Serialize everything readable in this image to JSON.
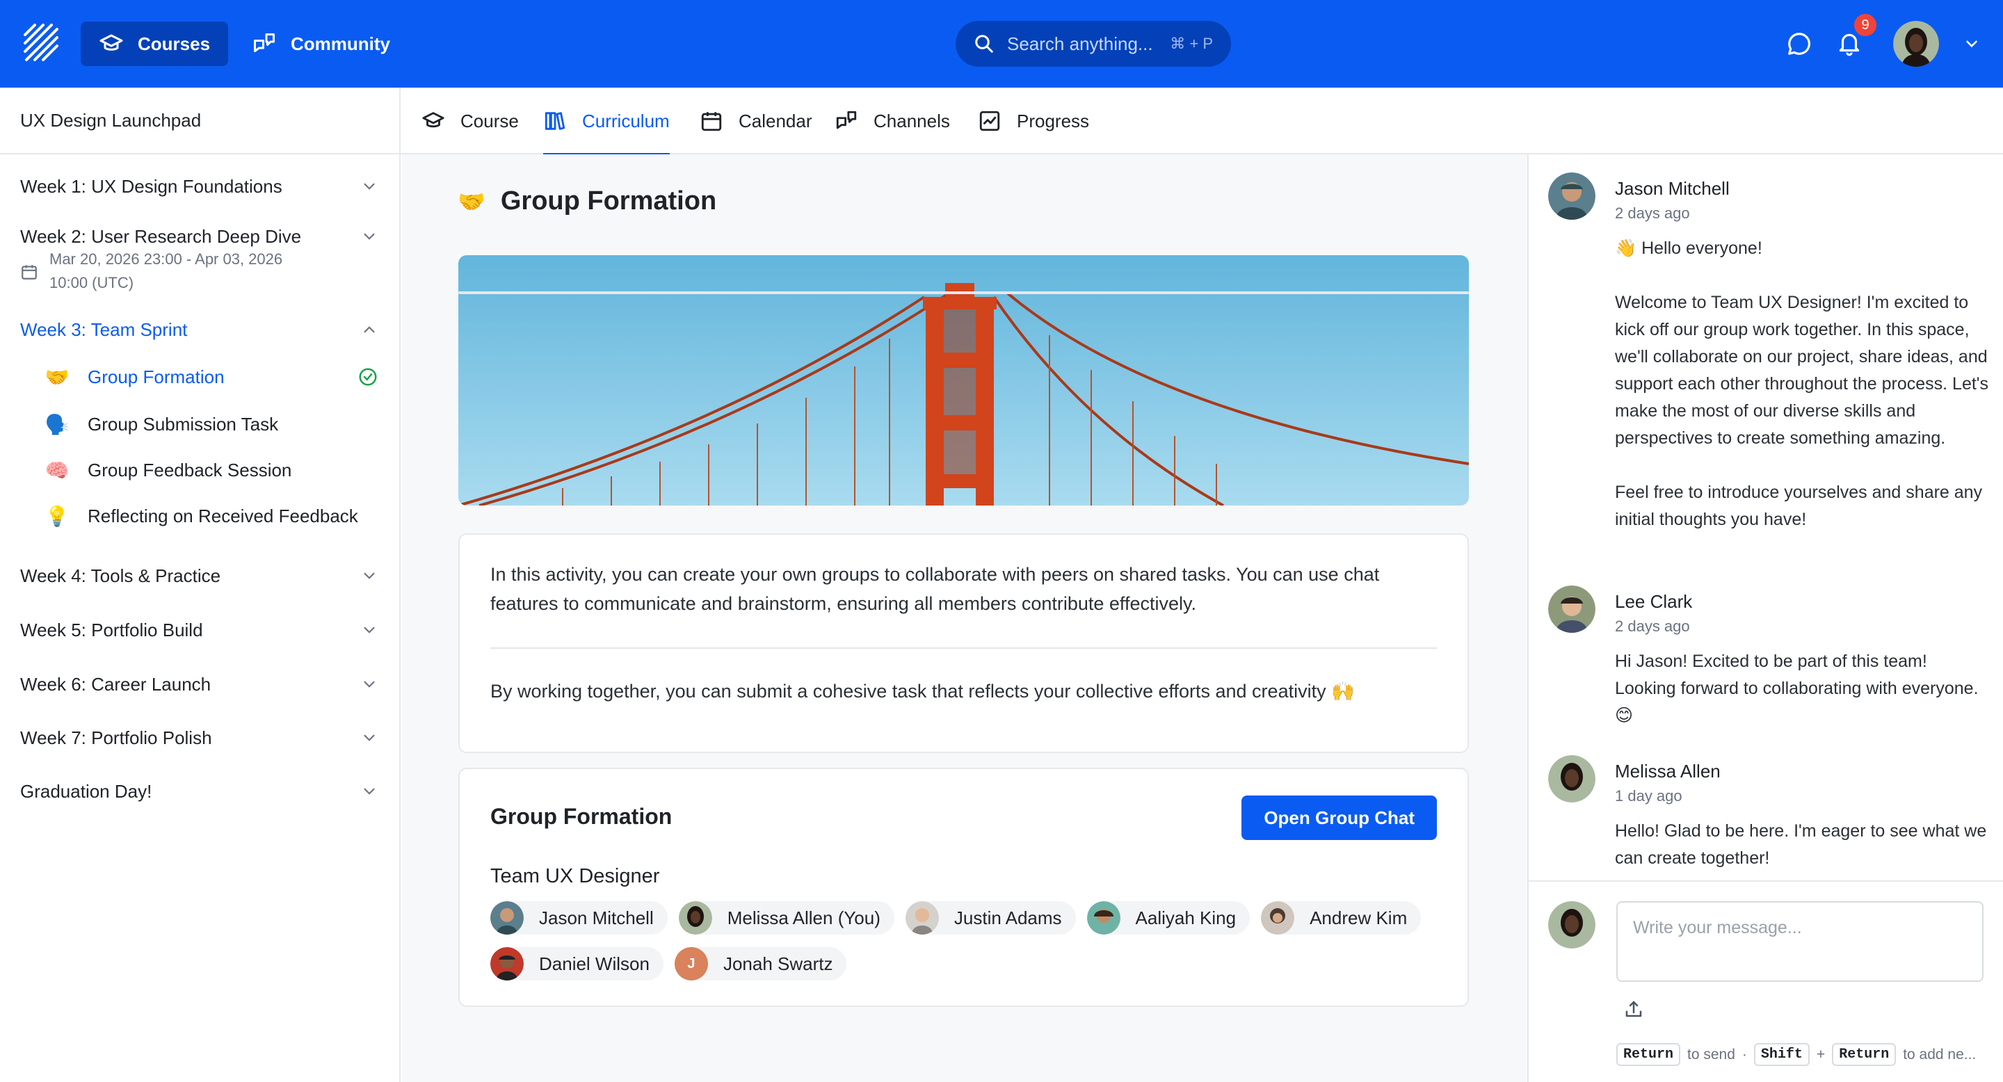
{
  "topbar": {
    "courses_label": "Courses",
    "community_label": "Community",
    "search_placeholder": "Search anything...",
    "search_shortcut": "⌘ + P",
    "notification_count": "9",
    "brand_color": "#0a5bf2"
  },
  "sidebar": {
    "course_title": "UX Design Launchpad",
    "weeks": [
      {
        "label": "Week 1: UX Design Foundations",
        "expanded": false
      },
      {
        "label": "Week 2: User Research Deep Dive",
        "expanded": false,
        "date_line1": "Mar 20, 2026 23:00 - Apr 03, 2026",
        "date_line2": "10:00 (UTC)"
      },
      {
        "label": "Week 3: Team Sprint",
        "expanded": true,
        "active": true
      },
      {
        "label": "Week 4: Tools & Practice",
        "expanded": false
      },
      {
        "label": "Week 5: Portfolio Build",
        "expanded": false
      },
      {
        "label": "Week 6: Career Launch",
        "expanded": false
      },
      {
        "label": "Week 7: Portfolio Polish",
        "expanded": false
      },
      {
        "label": "Graduation Day!",
        "expanded": false
      }
    ],
    "lessons": [
      {
        "emoji": "🤝",
        "label": "Group Formation",
        "active": true,
        "completed": true
      },
      {
        "emoji": "🗣️",
        "label": "Group Submission Task"
      },
      {
        "emoji": "🧠",
        "label": "Group Feedback Session"
      },
      {
        "emoji": "💡",
        "label": "Reflecting on Received Feedback"
      }
    ]
  },
  "tabs": [
    {
      "label": "Course",
      "icon": "graduation-cap-icon"
    },
    {
      "label": "Curriculum",
      "icon": "library-icon",
      "active": true
    },
    {
      "label": "Calendar",
      "icon": "calendar-icon"
    },
    {
      "label": "Channels",
      "icon": "chat-bubbles-icon"
    },
    {
      "label": "Progress",
      "icon": "chart-icon"
    }
  ],
  "main": {
    "title_emoji": "🤝",
    "title": "Group Formation",
    "description_1": "In this activity, you can create your own groups to collaborate with peers on shared tasks. You can use chat features to communicate and brainstorm, ensuring all members contribute effectively.",
    "description_2": "By working together, you can submit a cohesive task that reflects your collective efforts and creativity 🙌",
    "group_card_title": "Group Formation",
    "open_chat_label": "Open Group Chat",
    "team_name": "Team UX Designer",
    "members": [
      {
        "name": "Jason Mitchell",
        "color": "#5b7f8c"
      },
      {
        "name": "Melissa Allen (You)",
        "color": "#3b2a22"
      },
      {
        "name": "Justin Adams",
        "color": "#b9b3ad"
      },
      {
        "name": "Aaliyah King",
        "color": "#6fb3a6"
      },
      {
        "name": "Andrew Kim",
        "color": "#4a3a32"
      },
      {
        "name": "Daniel Wilson",
        "color": "#c0392b"
      },
      {
        "name": "Jonah Swartz",
        "initial": "J",
        "color": "#d9825b"
      }
    ]
  },
  "chat": {
    "messages": [
      {
        "author": "Jason Mitchell",
        "time": "2 days ago",
        "text": "👋 Hello everyone!\n\nWelcome to Team UX Designer! I'm excited to kick off our group work together. In this space, we'll collaborate on our project, share ideas, and support each other throughout the process. Let's make the most of our diverse skills and perspectives to create something amazing.\n\nFeel free to introduce yourselves and share any initial thoughts you have!"
      },
      {
        "author": "Lee Clark",
        "time": "2 days ago",
        "text": "Hi Jason! Excited to be part of this team! Looking forward to collaborating with everyone. 😊"
      },
      {
        "author": "Melissa Allen",
        "time": "1 day ago",
        "text": "Hello! Glad to be here. I'm eager to see what we can create together!"
      }
    ],
    "composer_placeholder": "Write your message...",
    "hint_return": "Return",
    "hint_send": "to send",
    "hint_dot": "·",
    "hint_shift": "Shift",
    "hint_plus": "+",
    "hint_return2": "Return",
    "hint_newline": "to add ne..."
  }
}
